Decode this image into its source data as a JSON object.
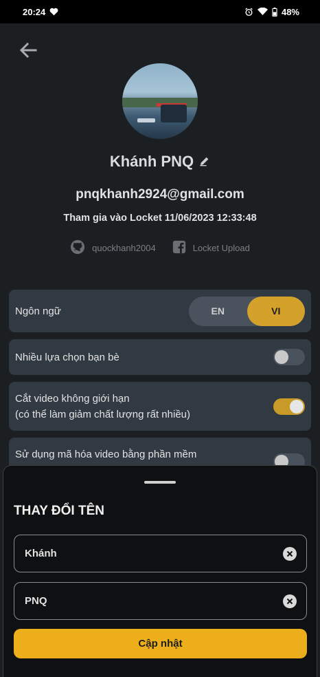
{
  "status_bar": {
    "time": "20:24",
    "battery": "48%",
    "icons": [
      "heart-icon",
      "alarm-icon",
      "wifi-icon",
      "battery-icon"
    ]
  },
  "profile": {
    "display_name": "Khánh PNQ",
    "email": "pnqkhanh2924@gmail.com",
    "joined": "Tham gia vào Locket 11/06/2023 12:33:48",
    "github": "quockhanh2004",
    "facebook": "Locket Upload"
  },
  "settings": {
    "language": {
      "label": "Ngôn ngữ",
      "options": [
        "EN",
        "VI"
      ],
      "selected": "VI"
    },
    "multi_friends": {
      "label": "Nhiều lựa chọn bạn bè",
      "enabled": false
    },
    "unlimited_video": {
      "label_line1": "Cắt video không giới hạn",
      "label_line2": "(có thể làm giảm chất lượng rất nhiều)",
      "enabled": true
    },
    "software_encoding": {
      "label_line1": "Sử dụng mã hóa video bằng phần mềm",
      "enabled": false
    }
  },
  "sheet": {
    "title": "THAY ĐỔI TÊN",
    "first_name": "Khánh",
    "last_name": "PNQ",
    "submit_label": "Cập nhật"
  },
  "colors": {
    "accent": "#ecaf1b",
    "toggle_on": "#c89a28",
    "card_bg": "#313942",
    "page_bg": "#1c1f22"
  }
}
